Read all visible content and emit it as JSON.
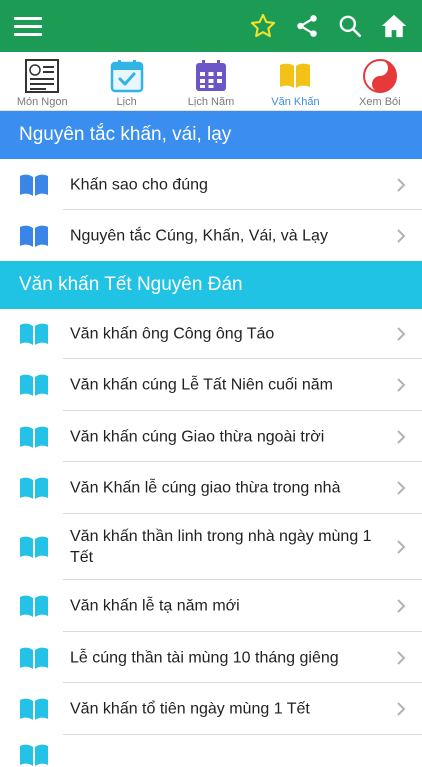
{
  "topbar": {
    "menu_icon": "hamburger-menu-icon",
    "actions": [
      "star-icon",
      "share-icon",
      "search-icon",
      "home-icon"
    ],
    "accent": "#1c9b55"
  },
  "tabs": [
    {
      "label": "Món Ngon",
      "icon": "food-menu-icon"
    },
    {
      "label": "Lịch",
      "icon": "calendar-check-icon"
    },
    {
      "label": "Lịch Năm",
      "icon": "calendar-grid-icon"
    },
    {
      "label": "Văn Khấn",
      "icon": "open-book-icon",
      "active": true
    },
    {
      "label": "Xem Bói",
      "icon": "yin-yang-icon"
    }
  ],
  "sections": [
    {
      "title": "Nguyên tắc khấn, vái, lạy",
      "color": "#3a8ef0",
      "book_color": "#3a86e8",
      "items": [
        "Khấn sao cho đúng",
        "Nguyên tắc Cúng, Khấn, Vái, và Lạy"
      ]
    },
    {
      "title": "Văn khấn Tết Nguyên Đán",
      "color": "#20c3e3",
      "book_color": "#24c2e6",
      "items": [
        "Văn khấn ông Công ông Táo",
        "Văn khấn cúng Lễ Tất Niên cuối năm",
        "Văn khấn cúng Giao thừa ngoài trời",
        "Văn Khấn lễ cúng giao thừa trong nhà",
        "Văn khấn thần linh trong nhà ngày mùng 1 Tết",
        "Văn khấn lễ tạ năm mới",
        "Lễ cúng thần tài mùng 10 tháng giêng",
        "Văn khấn tổ tiên ngày mùng 1 Tết"
      ]
    }
  ]
}
